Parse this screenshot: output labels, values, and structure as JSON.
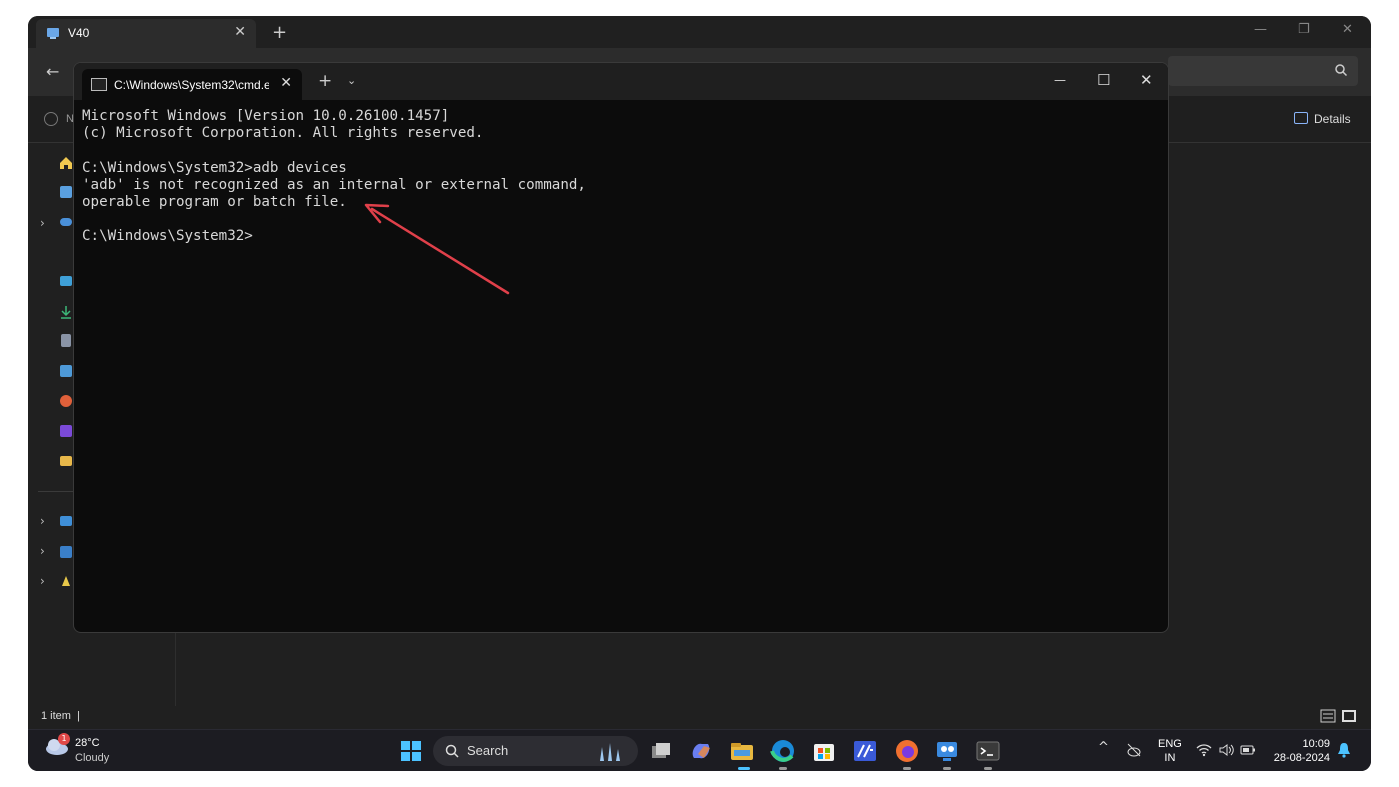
{
  "explorer": {
    "tab_title": "V40",
    "tab_close": "✕",
    "new_tab": "+",
    "back": "←",
    "details_label": "Details",
    "new_label": "N",
    "status_text": "1 item",
    "status_sep": "|"
  },
  "cmd": {
    "tab_title": "C:\\Windows\\System32\\cmd.e",
    "tab_close": "✕",
    "new_tab": "+",
    "dropdown": "⌄",
    "minimize": "—",
    "maximize": "☐",
    "close": "✕",
    "lines": [
      "Microsoft Windows [Version 10.0.26100.1457]",
      "(c) Microsoft Corporation. All rights reserved.",
      "",
      "C:\\Windows\\System32>adb devices",
      "'adb' is not recognized as an internal or external command,",
      "operable program or batch file.",
      "",
      "C:\\Windows\\System32>"
    ]
  },
  "taskbar": {
    "weather_temp": "28°C",
    "weather_cond": "Cloudy",
    "weather_badge": "1",
    "search_label": "Search",
    "lang_line1": "ENG",
    "lang_line2": "IN",
    "time": "10:09",
    "date": "28-08-2024",
    "tray_chevron": "^"
  },
  "colors": {
    "annotation_arrow": "#e0404a",
    "accent": "#4cc2ff"
  }
}
